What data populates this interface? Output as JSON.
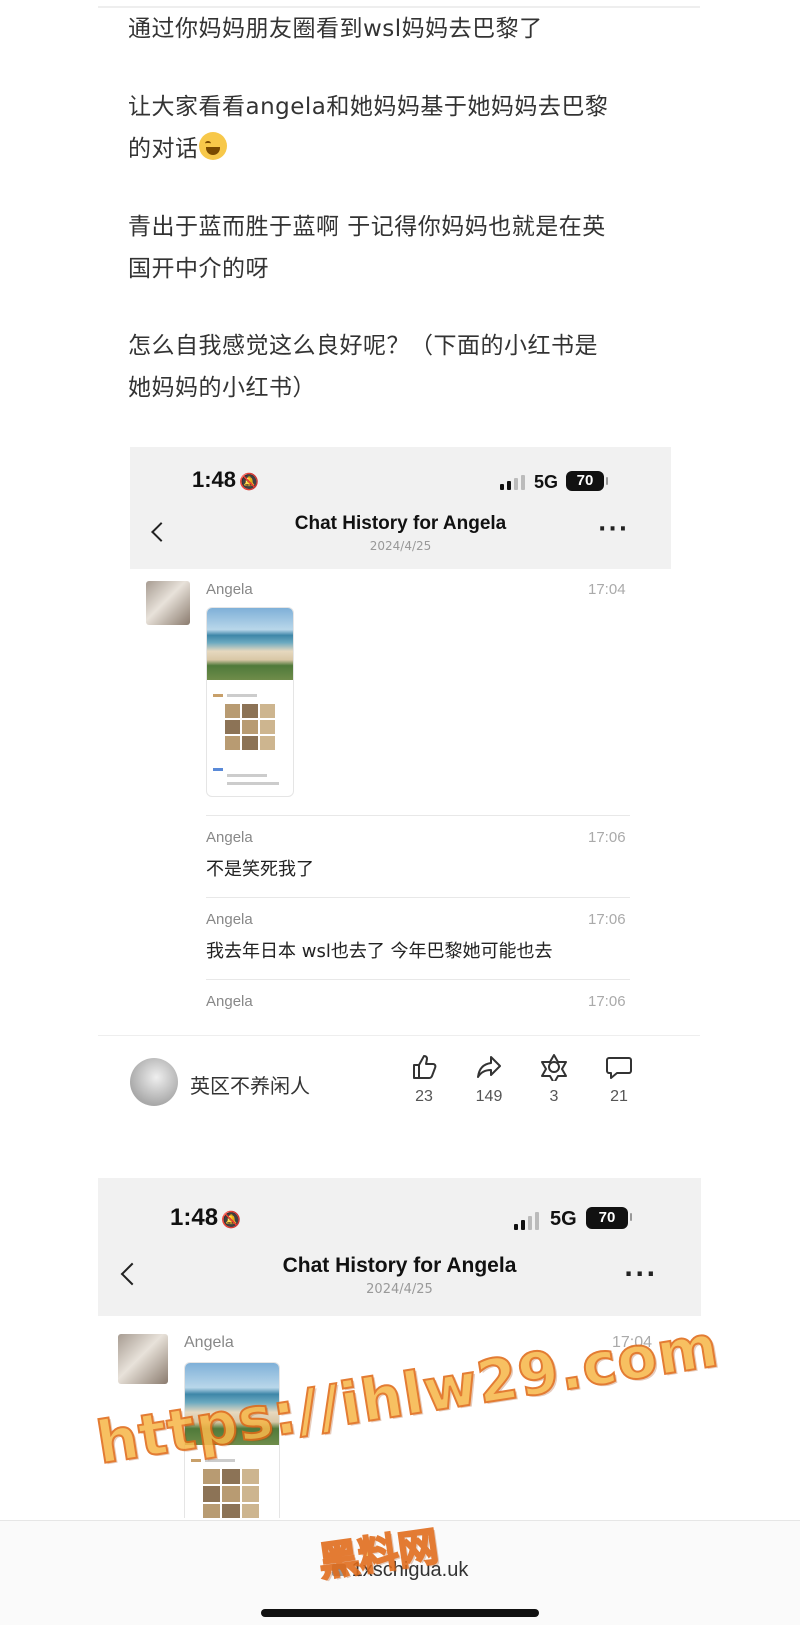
{
  "post": {
    "paragraphs": [
      "通过你妈妈朋友圈看到wsl妈妈去巴黎了",
      "让大家看看angela和她妈妈基于她妈妈去巴黎",
      "的对话",
      "青出于蓝而胜于蓝啊 于记得你妈妈也就是在英",
      "国开中介的呀",
      "怎么自我感觉这么良好呢？（下面的小红书是",
      "她妈妈的小红书）"
    ]
  },
  "screenshot1": {
    "status_time": "1:48",
    "network": "5G",
    "battery": "70",
    "title": "Chat History for Angela",
    "date": "2024/4/25",
    "messages": [
      {
        "sender": "Angela",
        "time": "17:04",
        "text": ""
      },
      {
        "sender": "Angela",
        "time": "17:06",
        "text": "不是笑死我了"
      },
      {
        "sender": "Angela",
        "time": "17:06",
        "text": "我去年日本 wsl也去了 今年巴黎她可能也去"
      },
      {
        "sender": "Angela",
        "time": "17:06",
        "text": ""
      }
    ]
  },
  "actions": {
    "username": "英区不养闲人",
    "like_count": "23",
    "share_count": "149",
    "collect_count": "3",
    "comment_count": "21"
  },
  "screenshot2": {
    "status_time": "1:48",
    "network": "5G",
    "battery": "70",
    "title": "Chat History for Angela",
    "date": "2024/4/25",
    "messages": [
      {
        "sender": "Angela",
        "time": "17:04"
      }
    ]
  },
  "browser": {
    "url": "1xschigua.uk"
  },
  "watermark": {
    "line1": "https://ihlw29.com",
    "line2": "黑料网"
  },
  "icons": [
    "bell-slash-icon",
    "signal-icon",
    "back-icon",
    "more-icon",
    "like-icon",
    "share-icon",
    "collect-icon",
    "comment-icon",
    "lock-icon"
  ]
}
